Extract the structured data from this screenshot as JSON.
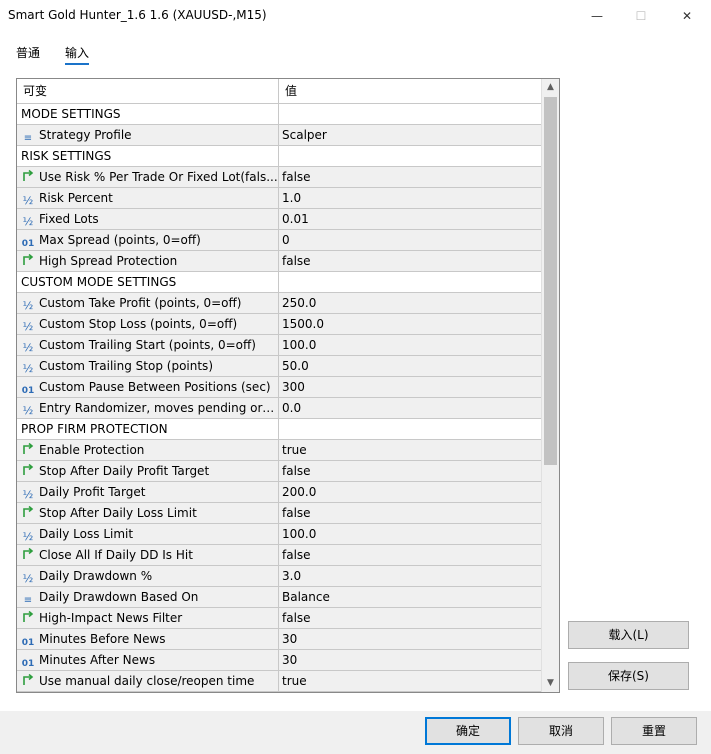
{
  "window": {
    "title": "Smart Gold Hunter_1.6 1.6 (XAUUSD-,M15)",
    "minimize": "—",
    "maximize": "☐",
    "close": "✕"
  },
  "tabs": [
    {
      "label": "普通"
    },
    {
      "label": "输入"
    }
  ],
  "grid": {
    "header_name": "可变",
    "header_value": "值",
    "rows": [
      {
        "type": "section",
        "name": "MODE SETTINGS",
        "value": ""
      },
      {
        "type": "param",
        "icon": "enum",
        "name": "Strategy Profile",
        "value": "Scalper"
      },
      {
        "type": "section",
        "name": "RISK SETTINGS",
        "value": ""
      },
      {
        "type": "param",
        "icon": "bool",
        "name": "Use Risk % Per Trade Or Fixed Lot(fals...",
        "value": "false"
      },
      {
        "type": "param",
        "icon": "double",
        "name": "Risk Percent",
        "value": "1.0"
      },
      {
        "type": "param",
        "icon": "double",
        "name": "Fixed Lots",
        "value": "0.01"
      },
      {
        "type": "param",
        "icon": "int",
        "name": "Max Spread (points, 0=off)",
        "value": "0"
      },
      {
        "type": "param",
        "icon": "bool",
        "name": "High Spread Protection",
        "value": "false"
      },
      {
        "type": "section",
        "name": "CUSTOM MODE SETTINGS",
        "value": ""
      },
      {
        "type": "param",
        "icon": "double",
        "name": "Custom Take Profit (points, 0=off)",
        "value": "250.0"
      },
      {
        "type": "param",
        "icon": "double",
        "name": "Custom Stop Loss (points, 0=off)",
        "value": "1500.0"
      },
      {
        "type": "param",
        "icon": "double",
        "name": "Custom Trailing Start (points, 0=off)",
        "value": "100.0"
      },
      {
        "type": "param",
        "icon": "double",
        "name": "Custom Trailing Stop (points)",
        "value": "50.0"
      },
      {
        "type": "param",
        "icon": "int",
        "name": "Custom Pause Between Positions (sec)",
        "value": "300"
      },
      {
        "type": "param",
        "icon": "double",
        "name": "Entry Randomizer, moves pending ord...",
        "value": "0.0"
      },
      {
        "type": "section",
        "name": "PROP FIRM PROTECTION",
        "value": ""
      },
      {
        "type": "param",
        "icon": "bool",
        "name": "Enable Protection",
        "value": "true"
      },
      {
        "type": "param",
        "icon": "bool",
        "name": "Stop After Daily Profit Target",
        "value": "false"
      },
      {
        "type": "param",
        "icon": "double",
        "name": "Daily Profit Target",
        "value": "200.0"
      },
      {
        "type": "param",
        "icon": "bool",
        "name": "Stop After Daily Loss Limit",
        "value": "false"
      },
      {
        "type": "param",
        "icon": "double",
        "name": "Daily Loss Limit",
        "value": "100.0"
      },
      {
        "type": "param",
        "icon": "bool",
        "name": "Close All If Daily DD Is Hit",
        "value": "false"
      },
      {
        "type": "param",
        "icon": "double",
        "name": "Daily Drawdown %",
        "value": "3.0"
      },
      {
        "type": "param",
        "icon": "enum",
        "name": "Daily Drawdown Based On",
        "value": "Balance"
      },
      {
        "type": "param",
        "icon": "bool",
        "name": "High-Impact News Filter",
        "value": "false"
      },
      {
        "type": "param",
        "icon": "int",
        "name": "Minutes Before News",
        "value": "30"
      },
      {
        "type": "param",
        "icon": "int",
        "name": "Minutes After News",
        "value": "30"
      },
      {
        "type": "param",
        "icon": "bool",
        "name": "Use manual daily close/reopen time",
        "value": "true"
      }
    ]
  },
  "icons": {
    "double": "½",
    "int": "01",
    "enum": "≡",
    "bool": "bool-arrow-icon"
  },
  "side_buttons": {
    "load": "载入(L)",
    "save": "保存(S)"
  },
  "footer": {
    "ok": "确定",
    "cancel": "取消",
    "reset": "重置"
  },
  "colors": {
    "accent": "#0078d7",
    "icon_blue": "#2d6bb5",
    "icon_green": "#2e9e3e"
  }
}
